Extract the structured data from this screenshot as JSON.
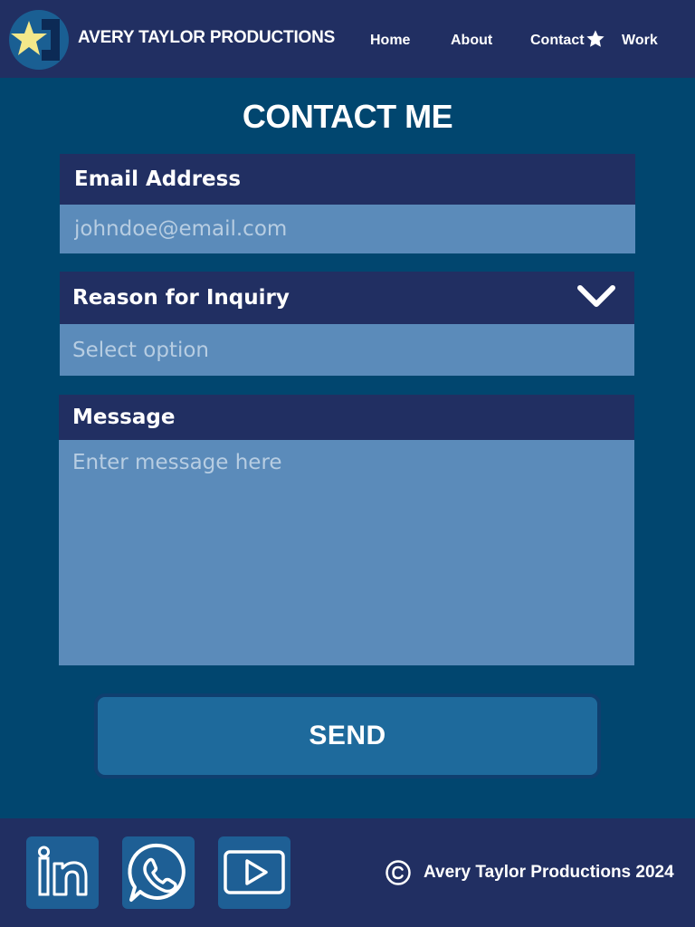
{
  "header": {
    "brand": "AVERY TAYLOR PRODUCTIONS",
    "logo_icon": "star-logo-icon",
    "nav": [
      {
        "label": "Home"
      },
      {
        "label": "About"
      },
      {
        "label": "Contact"
      },
      {
        "label": "Work"
      }
    ],
    "active_icon": "star-icon"
  },
  "main": {
    "title": "CONTACT ME",
    "email": {
      "label": "Email Address",
      "placeholder": "johndoe@email.com",
      "value": ""
    },
    "reason": {
      "label": "Reason for Inquiry",
      "selected": "Select option",
      "icon": "chevron-down-icon"
    },
    "message": {
      "label": "Message",
      "placeholder": "Enter message here",
      "value": ""
    },
    "send_label": "SEND"
  },
  "footer": {
    "social": [
      {
        "icon": "linkedin-icon"
      },
      {
        "icon": "whatsapp-icon"
      },
      {
        "icon": "youtube-icon"
      }
    ],
    "copyright_icon": "copyright-icon",
    "copyright_text": "Avery Taylor Productions 2024"
  },
  "colors": {
    "header_bg": "#212f62",
    "page_bg": "#01466f",
    "field_bg": "#5b8bba",
    "button_bg": "#1e6a9c",
    "placeholder": "#b7cde2",
    "logo_star": "#f3e88a"
  }
}
